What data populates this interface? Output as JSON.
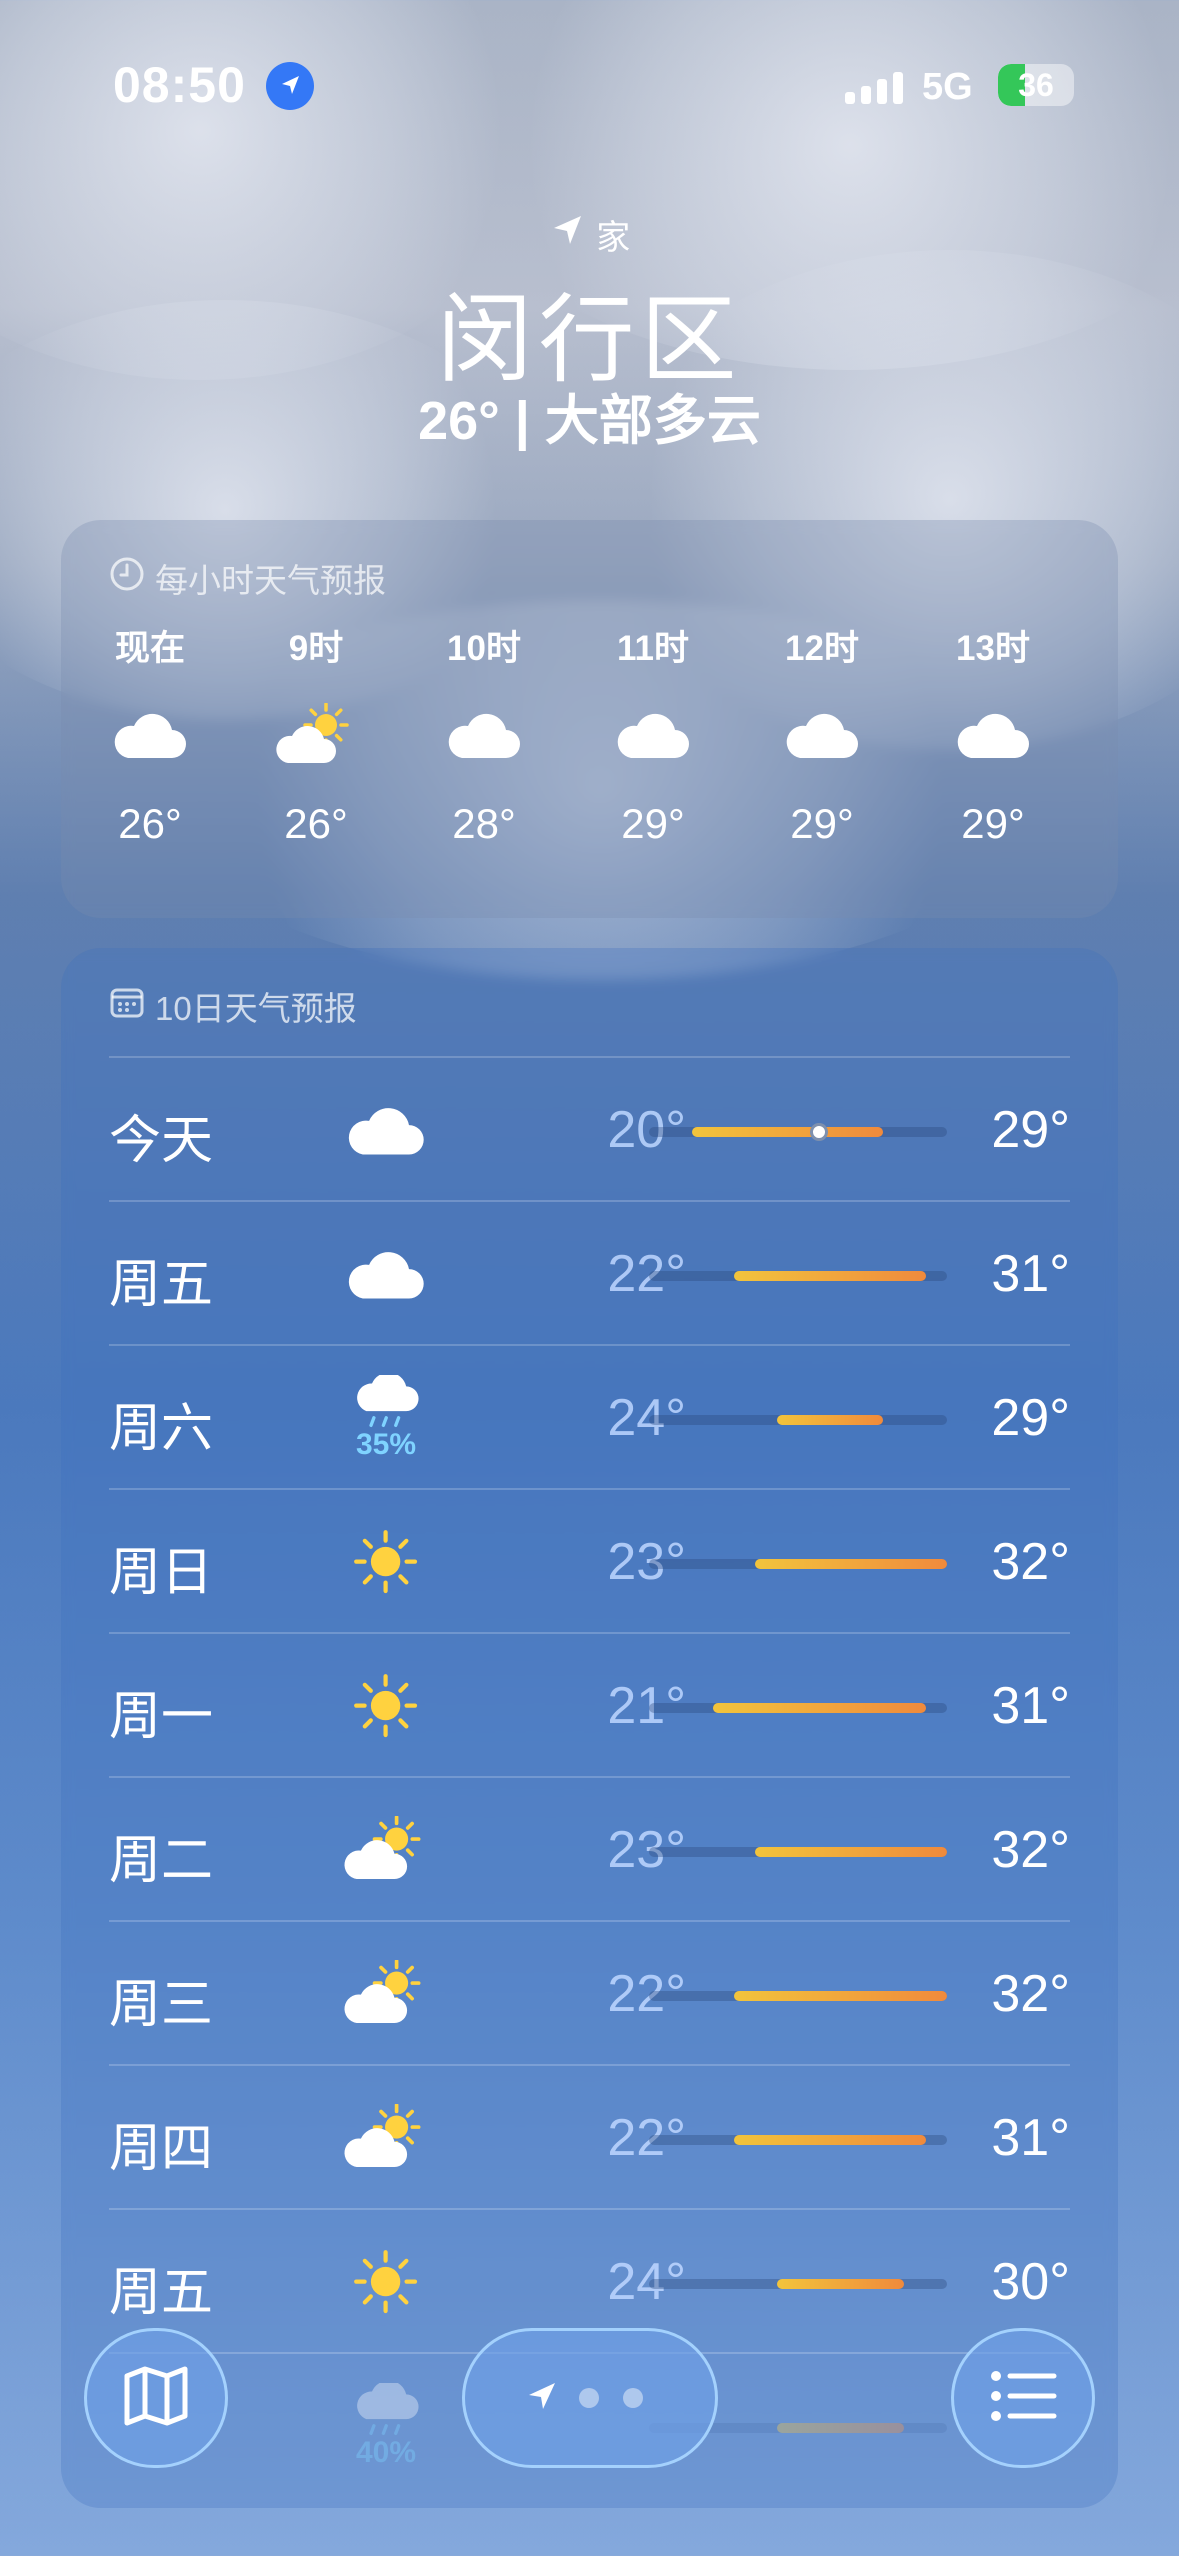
{
  "status": {
    "time": "08:50",
    "network": "5G",
    "battery": "36",
    "battery_level": 0.36
  },
  "header": {
    "home_label": "家",
    "city": "闵行区",
    "summary": "26° | 大部多云"
  },
  "hourly": {
    "title": "每小时天气预报",
    "items": [
      {
        "label": "现在",
        "icon": "cloud-icon",
        "temp": "26°"
      },
      {
        "label": "9时",
        "icon": "partly-sunny-icon",
        "temp": "26°"
      },
      {
        "label": "10时",
        "icon": "cloud-icon",
        "temp": "28°"
      },
      {
        "label": "11时",
        "icon": "cloud-icon",
        "temp": "29°"
      },
      {
        "label": "12时",
        "icon": "cloud-icon",
        "temp": "29°"
      },
      {
        "label": "13时",
        "icon": "cloud-icon",
        "temp": "29°"
      }
    ]
  },
  "daily": {
    "title": "10日天气预报",
    "days": [
      {
        "day": "今天",
        "icon": "cloud-icon",
        "precip": "",
        "low": "20°",
        "high": "29°",
        "low_val": 20,
        "high_val": 29,
        "current_val": 26
      },
      {
        "day": "周五",
        "icon": "cloud-icon",
        "precip": "",
        "low": "22°",
        "high": "31°",
        "low_val": 22,
        "high_val": 31
      },
      {
        "day": "周六",
        "icon": "rain-cloud-icon",
        "precip": "35%",
        "low": "24°",
        "high": "29°",
        "low_val": 24,
        "high_val": 29
      },
      {
        "day": "周日",
        "icon": "sun-icon",
        "precip": "",
        "low": "23°",
        "high": "32°",
        "low_val": 23,
        "high_val": 32
      },
      {
        "day": "周一",
        "icon": "sun-icon",
        "precip": "",
        "low": "21°",
        "high": "31°",
        "low_val": 21,
        "high_val": 31
      },
      {
        "day": "周二",
        "icon": "partly-sunny-icon",
        "precip": "",
        "low": "23°",
        "high": "32°",
        "low_val": 23,
        "high_val": 32
      },
      {
        "day": "周三",
        "icon": "partly-sunny-icon",
        "precip": "",
        "low": "22°",
        "high": "32°",
        "low_val": 22,
        "high_val": 32
      },
      {
        "day": "周四",
        "icon": "partly-sunny-icon",
        "precip": "",
        "low": "22°",
        "high": "31°",
        "low_val": 22,
        "high_val": 31
      },
      {
        "day": "周五",
        "icon": "sun-icon",
        "precip": "",
        "low": "24°",
        "high": "30°",
        "low_val": 24,
        "high_val": 30
      },
      {
        "day": "",
        "icon": "rain-cloud-icon",
        "precip": "40%",
        "low": "",
        "high": "",
        "low_val": 24,
        "high_val": 30
      }
    ],
    "scale_min": 18,
    "scale_max": 32
  },
  "toolbar": {
    "map_icon": "map-icon",
    "location_icon": "location-arrow-icon",
    "list_icon": "list-icon",
    "page_count": 3
  }
}
